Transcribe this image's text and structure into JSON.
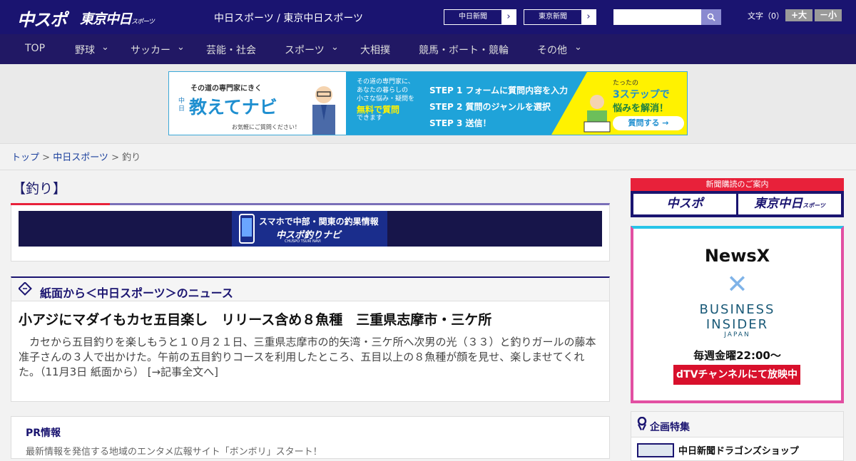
{
  "header": {
    "logo_main": "中スポ",
    "logo_tokyo": "東京中日",
    "logo_tokyo_small": "スポーツ",
    "site_links": "中日スポーツ / 東京中日スポーツ",
    "paper_button_1": "中日新聞",
    "paper_button_2": "東京新聞",
    "font_size_label": "文字（0）",
    "font_bigger": "+大",
    "font_smaller": "－小",
    "search_placeholder": ""
  },
  "nav": {
    "items": [
      {
        "label": "TOP"
      },
      {
        "label": "野球"
      },
      {
        "label": "サッカー"
      },
      {
        "label": "芸能・社会"
      },
      {
        "label": "スポーツ"
      },
      {
        "label": "大相撲"
      },
      {
        "label": "競馬・ボート・競輪"
      },
      {
        "label": "その他"
      }
    ]
  },
  "ad_banner": {
    "left_tagline": "その道の専門家にきく",
    "left_brand_small": "中日",
    "left_brand": "教えてナビ",
    "left_note": "お気軽にご質問ください！",
    "mid_line1": "その道の専門家に、",
    "mid_line2": "あなたの暮らしの",
    "mid_line3": "小さな悩み・疑問を",
    "mid_free": "無料で質問",
    "mid_end": "できます",
    "step1": "STEP 1 フォームに質問内容を入力",
    "step2": "STEP 2 質問のジャンルを選択",
    "step3": "STEP 3 送信！",
    "right_small": "たったの",
    "right_big": "3ステップで",
    "right_big2": "悩みを解消！",
    "right_button": "質問する →"
  },
  "breadcrumb": {
    "home": "トップ",
    "section": "中日スポーツ",
    "current": "釣り"
  },
  "category_title": "【釣り】",
  "navi_banner": {
    "line1": "スマホで中部・関東の釣果情報",
    "line2": "中スポ釣りナビ",
    "line3": "CHUSPO TSURI NAVI"
  },
  "news": {
    "section_title": "紙面から＜中日スポーツ＞のニュース",
    "article_title": "小アジにマダイもカセ五目楽し　リリース含め８魚種　三重県志摩市・三ケ所",
    "article_body": "　カセから五目釣りを楽しもうと１０月２１日、三重県志摩市の的矢湾・三ケ所へ次男の光（３３）と釣りガールの藤本准子さんの３人で出かけた。午前の五目釣りコースを利用したところ、五目以上の８魚種が顔を見せ、楽しませてくれた。（11月3日 紙面から）",
    "article_more": "[→記事全文へ]"
  },
  "pr": {
    "title": "PR情報",
    "text": "最新情報を発信する地域のエンタメ広報サイト「ボンボリ」スタート！"
  },
  "subscription": {
    "header": "新聞購読のご案内",
    "btn1": "中スポ",
    "btn2": "東京中日",
    "btn2_small": "スポーツ"
  },
  "dtv_ad": {
    "newsx": "NewsX",
    "cross": "✕",
    "bi_line1": "BUSINESS",
    "bi_line2": "INSIDER",
    "bi_line3": "JAPAN",
    "weekly": "毎週金曜22:00〜",
    "button": "dTVチャンネルにて放映中"
  },
  "feature": {
    "title": "企画特集",
    "item": "中日新聞ドラゴンズショップ"
  },
  "colors": {
    "header_bg": "#1a1470",
    "nav_bg": "#211864",
    "accent_red": "#e8213a",
    "link_blue": "#1a3f9c"
  }
}
